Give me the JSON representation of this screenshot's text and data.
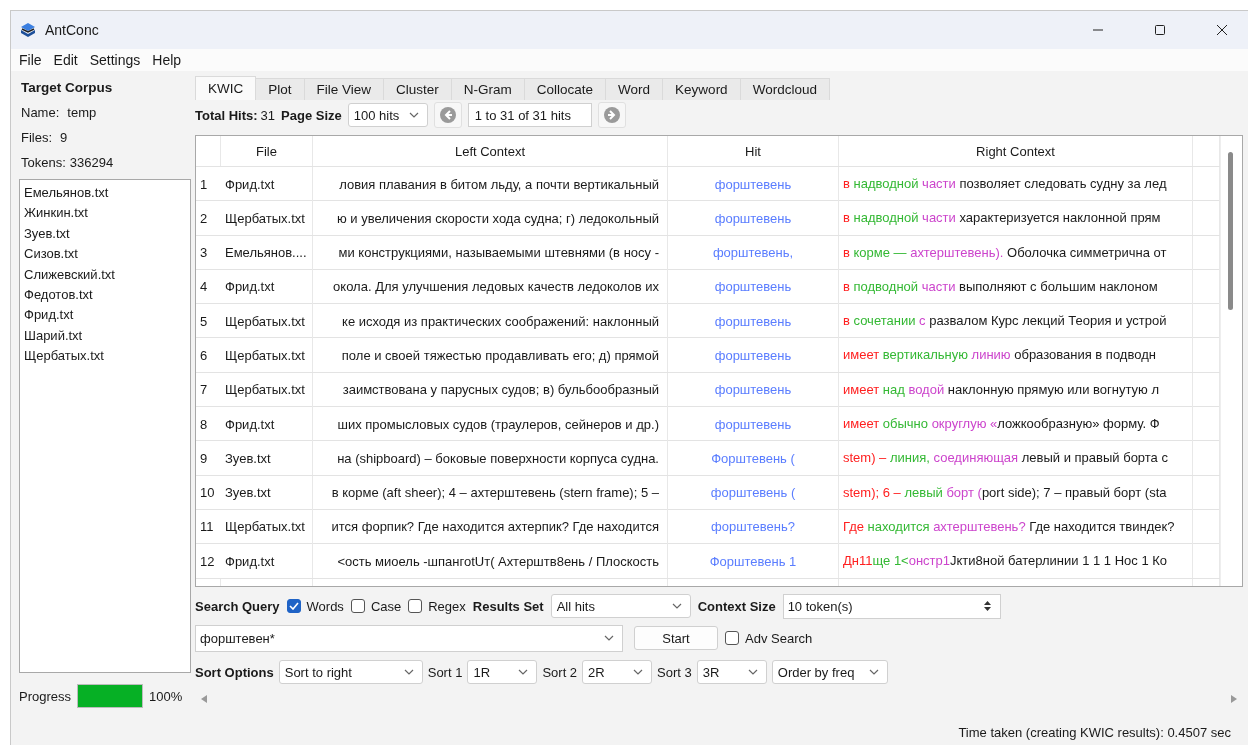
{
  "window": {
    "title": "AntConc"
  },
  "menu": [
    "File",
    "Edit",
    "Settings",
    "Help"
  ],
  "sidebar": {
    "title": "Target Corpus",
    "name_label": "Name:",
    "name_value": "temp",
    "files_label": "Files:",
    "files_value": "9",
    "tokens_label": "Tokens:",
    "tokens_value": "336294",
    "files": [
      "Емельянов.txt",
      "Жинкин.txt",
      "Зуев.txt",
      "Сизов.txt",
      "Слижевский.txt",
      "Федотов.txt",
      "Фрид.txt",
      "Шарий.txt",
      "Щербатых.txt"
    ],
    "progress": {
      "label": "Progress",
      "level": 1,
      "reading": "100%"
    }
  },
  "tabs": [
    {
      "label": "KWIC",
      "selected": true
    },
    {
      "label": "Plot",
      "selected": false
    },
    {
      "label": "File View",
      "selected": false
    },
    {
      "label": "Cluster",
      "selected": false
    },
    {
      "label": "N-Gram",
      "selected": false
    },
    {
      "label": "Collocate",
      "selected": false
    },
    {
      "label": "Word",
      "selected": false
    },
    {
      "label": "Keyword",
      "selected": false
    },
    {
      "label": "Wordcloud",
      "selected": false
    }
  ],
  "toolbar": {
    "total_hits_label": "Total Hits:",
    "total_hits": "31",
    "page_size_label": "Page Size",
    "page_size": "100 hits",
    "page_range": "1 to 31 of 31 hits"
  },
  "table": {
    "columns": [
      "File",
      "Left Context",
      "Hit",
      "Right Context"
    ],
    "rows": [
      {
        "number": "1",
        "file": "Фрид.txt",
        "left": "ловия плавания в битом льду, а почти вертикальный",
        "hit": "форштевень",
        "right": [
          {
            "kind": "sort1",
            "text": "в "
          },
          {
            "kind": "sort2",
            "text": "надводной "
          },
          {
            "kind": "sort3",
            "text": "части "
          },
          {
            "kind": "plain",
            "text": "позволяет следовать судну за лед"
          }
        ]
      },
      {
        "number": "2",
        "file": "Щербатых.txt",
        "left": "ю и увеличения скорости хода судна; г) ледокольный",
        "hit": "форштевень",
        "right": [
          {
            "kind": "sort1",
            "text": "в "
          },
          {
            "kind": "sort2",
            "text": "надводной "
          },
          {
            "kind": "sort3",
            "text": "части "
          },
          {
            "kind": "plain",
            "text": "характеризуется наклонной прям"
          }
        ]
      },
      {
        "number": "3",
        "file": "Емельянов....",
        "left": "ми конструкциями, называемыми штевнями (в носу -",
        "hit": "форштевень,",
        "right": [
          {
            "kind": "sort1",
            "text": "в "
          },
          {
            "kind": "sort2",
            "text": "корме — "
          },
          {
            "kind": "sort3",
            "text": "ахтерштевень). "
          },
          {
            "kind": "plain",
            "text": "Оболочка симметрична от"
          }
        ]
      },
      {
        "number": "4",
        "file": "Фрид.txt",
        "left": "окола. Для улучшения ледовых качеств ледоколов их",
        "hit": "форштевень",
        "right": [
          {
            "kind": "sort1",
            "text": "в "
          },
          {
            "kind": "sort2",
            "text": "подводной "
          },
          {
            "kind": "sort3",
            "text": "части "
          },
          {
            "kind": "plain",
            "text": "выполняют с большим наклоном"
          }
        ]
      },
      {
        "number": "5",
        "file": "Щербатых.txt",
        "left": "ке исходя из практических соображений: наклонный",
        "hit": "форштевень",
        "right": [
          {
            "kind": "sort1",
            "text": "в "
          },
          {
            "kind": "sort2",
            "text": "сочетании "
          },
          {
            "kind": "sort3",
            "text": "с "
          },
          {
            "kind": "plain",
            "text": "развалом Курс лекций Теория и устрой"
          }
        ]
      },
      {
        "number": "6",
        "file": "Щербатых.txt",
        "left": "поле и своей тяжестью продавливать его; д) прямой",
        "hit": "форштевень",
        "right": [
          {
            "kind": "sort1",
            "text": "имеет "
          },
          {
            "kind": "sort2",
            "text": "вертикальную "
          },
          {
            "kind": "sort3",
            "text": "линию "
          },
          {
            "kind": "plain",
            "text": "образования в подводн"
          }
        ]
      },
      {
        "number": "7",
        "file": "Щербатых.txt",
        "left": "заимствована у парусных судов; в) бульбообразный",
        "hit": "форштевень",
        "right": [
          {
            "kind": "sort1",
            "text": "имеет "
          },
          {
            "kind": "sort2",
            "text": "над "
          },
          {
            "kind": "sort3",
            "text": "водой "
          },
          {
            "kind": "plain",
            "text": "наклонную прямую или вогнутую л"
          }
        ]
      },
      {
        "number": "8",
        "file": "Фрид.txt",
        "left": "ших промысловых судов (траулеров, сейнеров и др.)",
        "hit": "форштевень",
        "right": [
          {
            "kind": "sort1",
            "text": "имеет "
          },
          {
            "kind": "sort2",
            "text": "обычно "
          },
          {
            "kind": "sort3",
            "text": "округлую «"
          },
          {
            "kind": "plain",
            "text": "ложкообразную» форму. Ф"
          }
        ]
      },
      {
        "number": "9",
        "file": "Зуев.txt",
        "left": "на (shipboard) – боковые поверхности корпуса судна.",
        "hit": "Форштевень (",
        "right": [
          {
            "kind": "sort1",
            "text": "stem) – "
          },
          {
            "kind": "sort2",
            "text": "линия, "
          },
          {
            "kind": "sort3",
            "text": "соединяющая "
          },
          {
            "kind": "plain",
            "text": "левый и правый борта с"
          }
        ]
      },
      {
        "number": "10",
        "file": "Зуев.txt",
        "left": "в корме (aft sheer); 4 – ахтерштевень (stern frame); 5 –",
        "hit": "форштевень (",
        "right": [
          {
            "kind": "sort1",
            "text": "stem); 6 – "
          },
          {
            "kind": "sort2",
            "text": "левый "
          },
          {
            "kind": "sort3",
            "text": "борт ("
          },
          {
            "kind": "plain",
            "text": "port side); 7 – правый борт (sta"
          }
        ]
      },
      {
        "number": "11",
        "file": "Щербатых.txt",
        "left": "ится форпик? Где находится ахтерпик? Где находится",
        "hit": "форштевень?",
        "right": [
          {
            "kind": "sort1",
            "text": "Где "
          },
          {
            "kind": "sort2",
            "text": "находится "
          },
          {
            "kind": "sort3",
            "text": "ахтерштевень? "
          },
          {
            "kind": "plain",
            "text": "Где находится твиндек?"
          }
        ]
      },
      {
        "number": "12",
        "file": "Фрид.txt",
        "left": "<ость миоель -шпангоtUт( Ахтерштв8ень / Плоскость",
        "hit": "Форштевень 1",
        "right": [
          {
            "kind": "sort1",
            "text": "Дн11"
          },
          {
            "kind": "sort2",
            "text": "ще 1<"
          },
          {
            "kind": "sort3",
            "text": "онстр1"
          },
          {
            "kind": "plain",
            "text": "Jкти8ной батерлинии 1 1 1 Нос 1 Ко"
          }
        ]
      }
    ]
  },
  "search": {
    "label": "Search Query",
    "words": {
      "label": "Words",
      "checked": true
    },
    "case": {
      "label": "Case",
      "checked": false
    },
    "regex": {
      "label": "Regex",
      "checked": false
    },
    "results_set_label": "Results Set",
    "results_set": "All hits",
    "context_size_label": "Context Size",
    "context_size": "10 token(s)",
    "query": "форштевен*",
    "start": "Start",
    "adv_search": {
      "label": "Adv Search",
      "checked": false
    }
  },
  "sort": {
    "label": "Sort Options",
    "mode": "Sort to right",
    "levels": [
      {
        "label": "Sort 1",
        "value": "1R"
      },
      {
        "label": "Sort 2",
        "value": "2R"
      },
      {
        "label": "Sort 3",
        "value": "3R"
      }
    ],
    "order": "Order by freq"
  },
  "status_bar": {
    "text": "Time taken (creating KWIC results):  0.4507 sec"
  }
}
